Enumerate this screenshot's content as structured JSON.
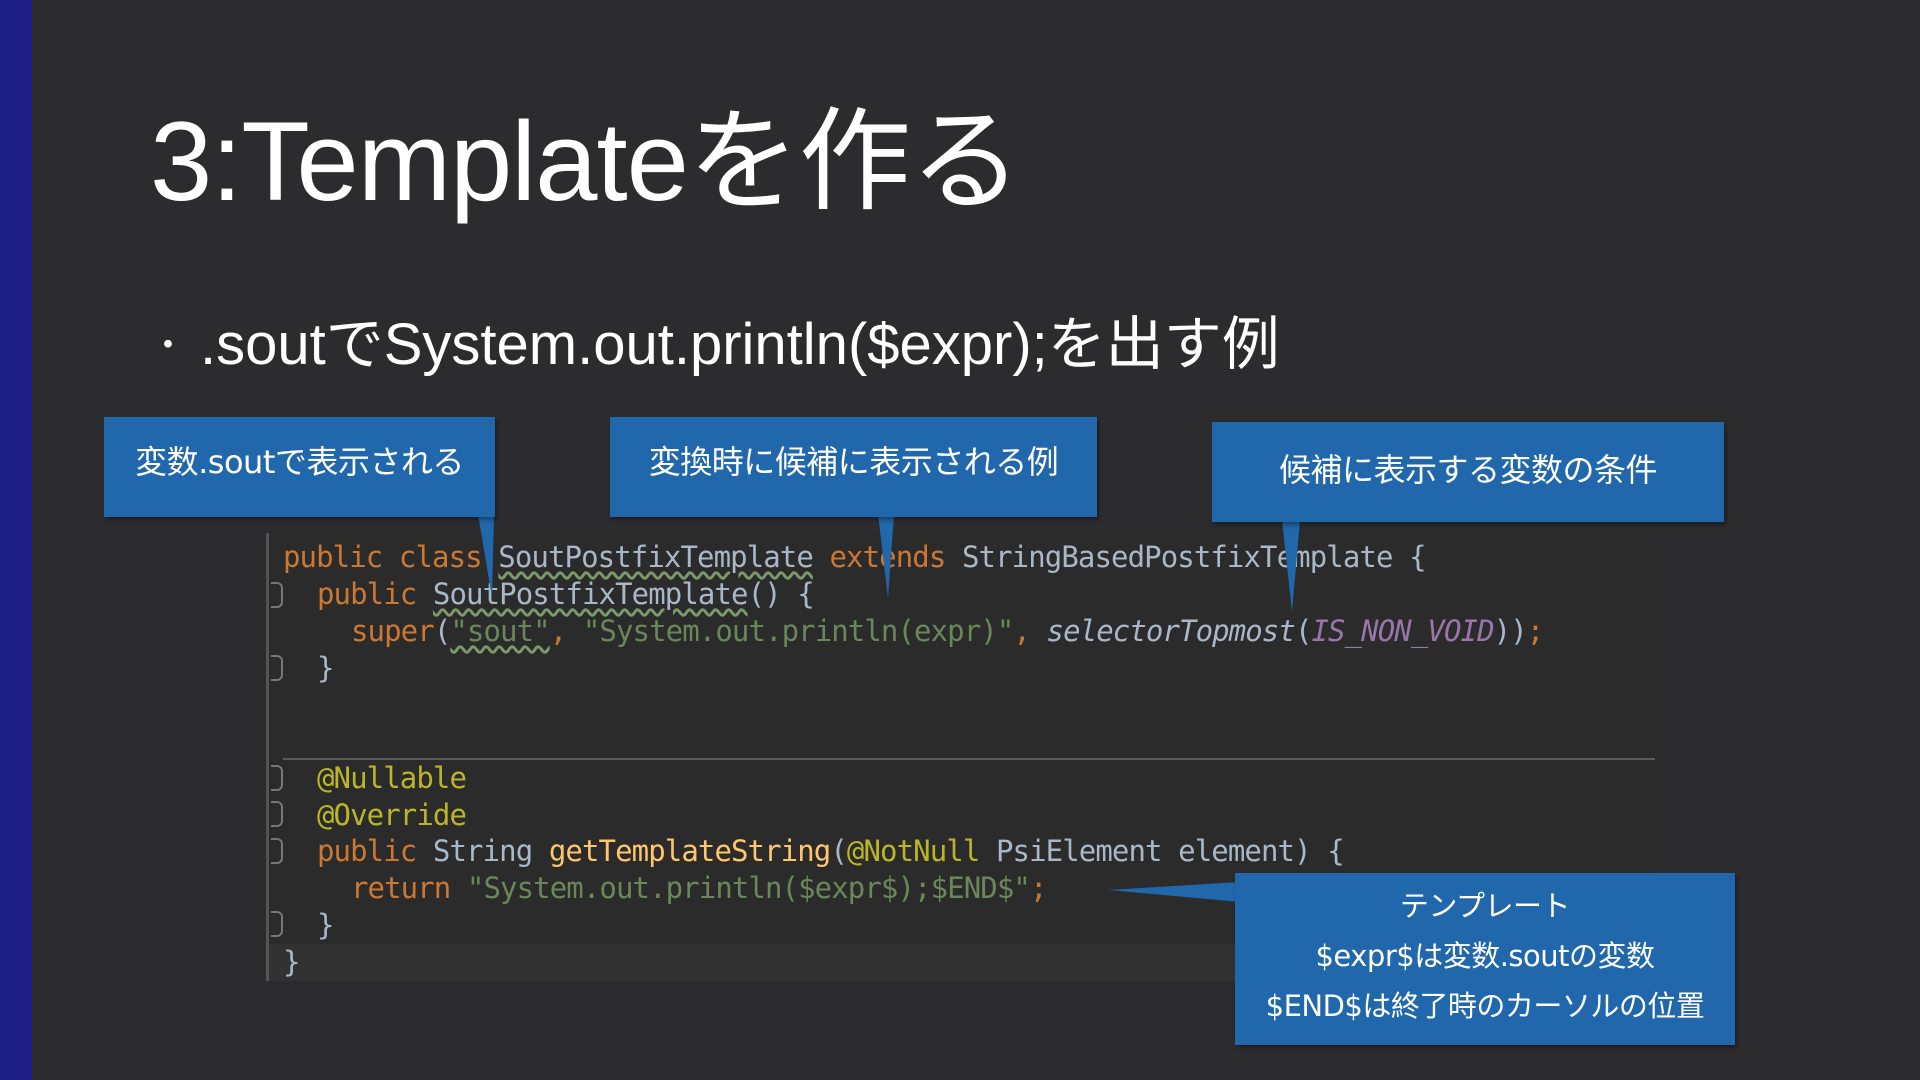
{
  "slide": {
    "title": "3:Templateを作る",
    "bullet": ".soutでSystem.out.println($expr);を出す例",
    "bullet_marker": "・"
  },
  "callouts": {
    "c1": "変数.soutで表示される",
    "c2": "変換時に候補に表示される例",
    "c3": "候補に表示する変数の条件",
    "c4": {
      "line1": "テンプレート",
      "line2": "$expr$は変数.soutの変数",
      "line3": "$END$は終了時のカーソルの位置"
    }
  },
  "code": {
    "l1": {
      "a": "public",
      "b": "class",
      "c": "SoutPostfixTemplate",
      "d": "extends",
      "e": "StringBasedPostfixTemplate",
      "f": "{"
    },
    "l2": {
      "a": "public",
      "b": "SoutPostfixTemplate",
      "c": "()",
      "d": "{"
    },
    "l3": {
      "a": "super",
      "b": "(",
      "c": "\"sout\"",
      "d": ",",
      "e": "\"System.out.println(expr)\"",
      "f": ",",
      "g": "selectorTopmost",
      "h": "(",
      "i": "IS_NON_VOID",
      "j": "))",
      "k": ";"
    },
    "l4": "}",
    "l5": "@Nullable",
    "l6": "@Override",
    "l7": {
      "a": "public",
      "b": "String",
      "c": "getTemplateString",
      "d": "(",
      "e": "@NotNull",
      "f": "PsiElement",
      "g": "element",
      "h": ")",
      "i": "{"
    },
    "l8": {
      "a": "return",
      "b": "\"System.out.println($expr$);$END$\"",
      "c": ";"
    },
    "l9": "}",
    "l10": "}"
  },
  "colors": {
    "background": "#2c2c2e",
    "accent_stripe": "#1d1f86",
    "callout": "#2167ab",
    "keyword": "#cc7832",
    "string": "#6a8759",
    "annotation": "#bbb529",
    "constant": "#9876aa"
  }
}
